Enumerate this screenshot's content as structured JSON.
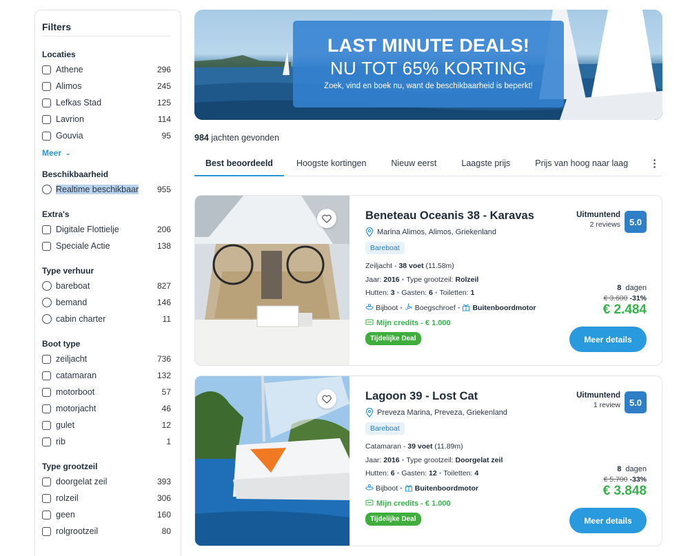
{
  "sidebar": {
    "title": "Filters",
    "locaties": {
      "title": "Locaties",
      "items": [
        {
          "label": "Athene",
          "count": "296"
        },
        {
          "label": "Alimos",
          "count": "245"
        },
        {
          "label": "Lefkas Stad",
          "count": "125"
        },
        {
          "label": "Lavrion",
          "count": "114"
        },
        {
          "label": "Gouvia",
          "count": "95"
        }
      ],
      "more": "Meer"
    },
    "beschikbaarheid": {
      "title": "Beschikbaarheid",
      "items": [
        {
          "label": "Realtime beschikbaar",
          "count": "955"
        }
      ]
    },
    "extras": {
      "title": "Extra's",
      "items": [
        {
          "label": "Digitale Flottielje",
          "count": "206"
        },
        {
          "label": "Speciale Actie",
          "count": "138"
        }
      ]
    },
    "type_verhuur": {
      "title": "Type verhuur",
      "items": [
        {
          "label": "bareboat",
          "count": "827"
        },
        {
          "label": "bemand",
          "count": "146"
        },
        {
          "label": "cabin charter",
          "count": "11"
        }
      ]
    },
    "boot_type": {
      "title": "Boot type",
      "items": [
        {
          "label": "zeiljacht",
          "count": "736"
        },
        {
          "label": "catamaran",
          "count": "132"
        },
        {
          "label": "motorboot",
          "count": "57"
        },
        {
          "label": "motorjacht",
          "count": "46"
        },
        {
          "label": "gulet",
          "count": "12"
        },
        {
          "label": "rib",
          "count": "1"
        }
      ]
    },
    "type_grootzeil": {
      "title": "Type grootzeil",
      "items": [
        {
          "label": "doorgelat zeil",
          "count": "393"
        },
        {
          "label": "rolzeil",
          "count": "306"
        },
        {
          "label": "geen",
          "count": "160"
        },
        {
          "label": "rolgrootzeil",
          "count": "80"
        }
      ]
    }
  },
  "banner": {
    "headline": "LAST MINUTE DEALS!",
    "subheadline": "NU TOT 65% KORTING",
    "tagline": "Zoek, vind en boek nu, want de beschikbaarheid is beperkt!"
  },
  "results": {
    "count": "984",
    "count_suffix": " jachten gevonden"
  },
  "tabs": [
    {
      "label": "Best beoordeeld"
    },
    {
      "label": "Hoogste kortingen"
    },
    {
      "label": "Nieuw eerst"
    },
    {
      "label": "Laagste prijs"
    },
    {
      "label": "Prijs van hoog naar laag"
    }
  ],
  "boats": [
    {
      "name": "Beneteau Oceanis 38 - Karavas",
      "location": "Marina Alimos, Alimos, Griekenland",
      "charter_type": "Bareboat",
      "kind": "Zeiljacht - ",
      "length_ft": "38 voet",
      "length_m": " (11.58m)",
      "year_label": "Jaar: ",
      "year": "2016",
      "sail_label": "Type grootzeil: ",
      "sail": "Rolzeil",
      "cabins_label": "Hutten: ",
      "cabins": "3",
      "guests_label": "Gasten: ",
      "guests": "6",
      "toilets_label": "Toiletten: ",
      "toilets": "1",
      "equip1": "Bijboot",
      "equip2": "Boegschroef",
      "equip3": "Buitenboordmotor",
      "credits": "Mijn credits -  € 1.000",
      "deal": "Tijdelijke Deal",
      "rating_word": "Uitmuntend",
      "reviews": "2 reviews",
      "score": "5.0",
      "days": "8",
      "days_label": "dagen",
      "old_price": "€ 3.600",
      "discount": "-31%",
      "price": "€ 2.484",
      "button": "Meer details"
    },
    {
      "name": "Lagoon 39 - Lost Cat",
      "location": "Preveza Marina, Preveza, Griekenland",
      "charter_type": "Bareboat",
      "kind": "Catamaran - ",
      "length_ft": "39 voet",
      "length_m": " (11.89m)",
      "year_label": "Jaar: ",
      "year": "2016",
      "sail_label": "Type grootzeil: ",
      "sail": "Doorgelat zeil",
      "cabins_label": "Hutten: ",
      "cabins": "6",
      "guests_label": "Gasten: ",
      "guests": "12",
      "toilets_label": "Toiletten: ",
      "toilets": "4",
      "equip1": "Bijboot",
      "equip2": "Buitenboordmotor",
      "credits": "Mijn credits -  € 1.000",
      "deal": "Tijdelijke Deal",
      "rating_word": "Uitmuntend",
      "reviews": "1 review",
      "score": "5.0",
      "days": "8",
      "days_label": "dagen",
      "old_price": "€ 5.700",
      "discount": "-33%",
      "price": "€ 3.848",
      "button": "Meer details"
    }
  ],
  "colors": {
    "accent": "#2a9ade",
    "price_green": "#37b24d",
    "deal_green": "#3fae3c",
    "score_blue": "#2f7fc6"
  },
  "icons": [
    "heart-icon",
    "location-pin-icon",
    "dinghy-icon",
    "propeller-icon",
    "gift-icon",
    "credits-icon",
    "chevron-down-icon",
    "more-vertical-icon"
  ]
}
